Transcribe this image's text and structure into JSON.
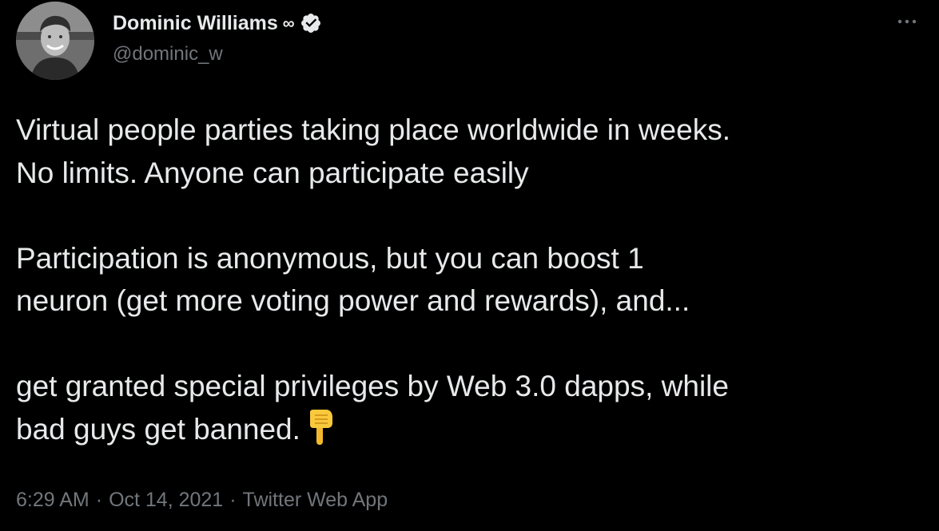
{
  "author": {
    "display_name": "Dominic Williams",
    "name_glyph": "∞",
    "handle": "@dominic_w",
    "verified": true
  },
  "icons": {
    "avatar": "profile-photo",
    "verified": "verified-badge-icon",
    "more": "more-options-icon",
    "emoji": "backhand-index-pointing-down-icon"
  },
  "tweet": {
    "paragraph_1": "Virtual people parties taking place worldwide in weeks.\nNo limits. Anyone can participate easily",
    "paragraph_2": "Participation is anonymous, but you can boost 1\nneuron (get more voting power and rewards), and...",
    "paragraph_3": "get granted special privileges by Web 3.0 dapps, while\nbad guys get banned."
  },
  "meta": {
    "time": "6:29 AM",
    "separator": "·",
    "date": "Oct 14, 2021",
    "source": "Twitter Web App"
  },
  "colors": {
    "background": "#000000",
    "text_primary": "#e7e9ea",
    "text_secondary": "#71767b",
    "emoji_yellow": "#f9c93c"
  }
}
